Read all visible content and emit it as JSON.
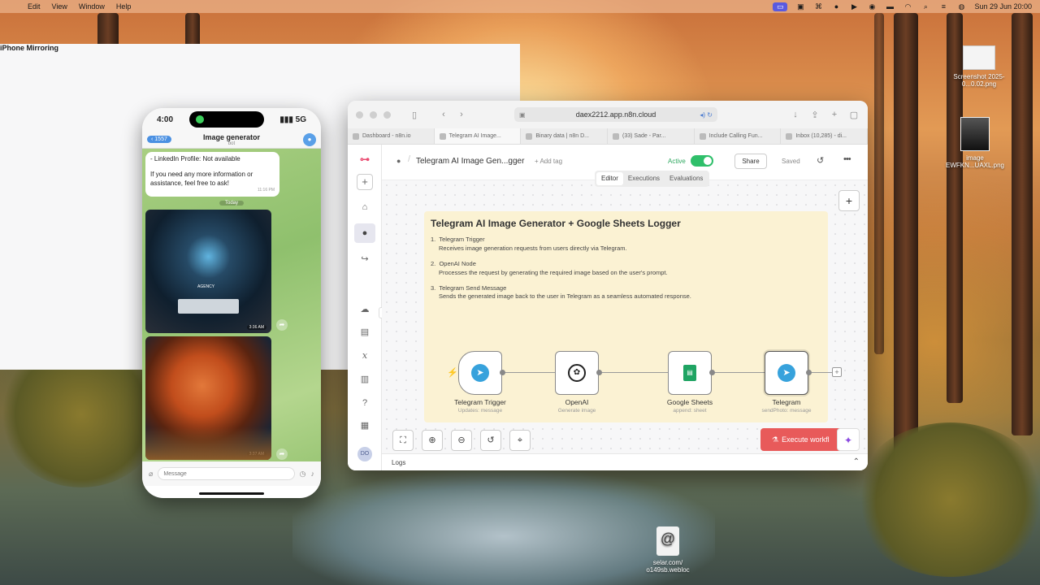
{
  "menubar": {
    "app": "iPhone Mirroring",
    "menus": [
      "Edit",
      "View",
      "Window",
      "Help"
    ],
    "datetime": "Sun 29 Jun  20:00"
  },
  "desktop": {
    "screenshot": "Screenshot 2025-0...0.02.png",
    "image": "image EWFKN...UAXL.png",
    "webloc": "selar.com/ o149sb.webloc"
  },
  "iphone": {
    "time": "4:00",
    "signal": "5G",
    "back_badge": "1557",
    "chat_title": "Image generator",
    "chat_subtitle": "bot",
    "message_lines": [
      "- LinkedIn Profile: Not available",
      "If you need any more information or assistance, feel free to ask!"
    ],
    "message_time": "11:16 PM",
    "day_label": "Today",
    "photo1_text": "AGENCY",
    "photo1_time": "3:36 AM",
    "photo2_time": "3:37 AM",
    "compose_placeholder": "Message"
  },
  "browser": {
    "url": "daex2212.app.n8n.cloud",
    "tabs": [
      "Dashboard - n8n.io",
      "Telegram AI Image...",
      "Binary data | n8n D...",
      "(33) Sade - Par...",
      "Include Calling Fun...",
      "Inbox (10,285) - di..."
    ]
  },
  "n8n": {
    "workflow_name": "Telegram AI Image Gen...gger",
    "add_tag": "+ Add tag",
    "active_label": "Active",
    "share_label": "Share",
    "saved_label": "Saved",
    "segments": [
      "Editor",
      "Executions",
      "Evaluations"
    ],
    "sidebar_avatar": "DO",
    "sticky": {
      "title": "Telegram AI Image Generator + Google Sheets Logger",
      "steps": [
        {
          "num": "1.",
          "title": "Telegram Trigger",
          "desc": "Receives image generation requests from users directly via Telegram."
        },
        {
          "num": "2.",
          "title": "OpenAI Node",
          "desc": "Processes the request by generating the required image based on the user's prompt."
        },
        {
          "num": "3.",
          "title": "Telegram Send Message",
          "desc": "Sends the generated image back to the user in Telegram as a seamless automated response."
        }
      ]
    },
    "nodes": [
      {
        "name": "Telegram Trigger",
        "sub": "Updates: message",
        "icon": "telegram-icon"
      },
      {
        "name": "OpenAI",
        "sub": "Generate image",
        "icon": "openai-icon"
      },
      {
        "name": "Google Sheets",
        "sub": "append: sheet",
        "icon": "google-sheets-icon"
      },
      {
        "name": "Telegram",
        "sub": "sendPhoto: message",
        "icon": "telegram-icon"
      }
    ],
    "execute_label": "Execute workfl",
    "logs_label": "Logs",
    "colors": {
      "accent": "#e85a5a",
      "active": "#2fbf6a",
      "sticky": "#fbf2d3",
      "brand": "#ea4b71"
    }
  }
}
